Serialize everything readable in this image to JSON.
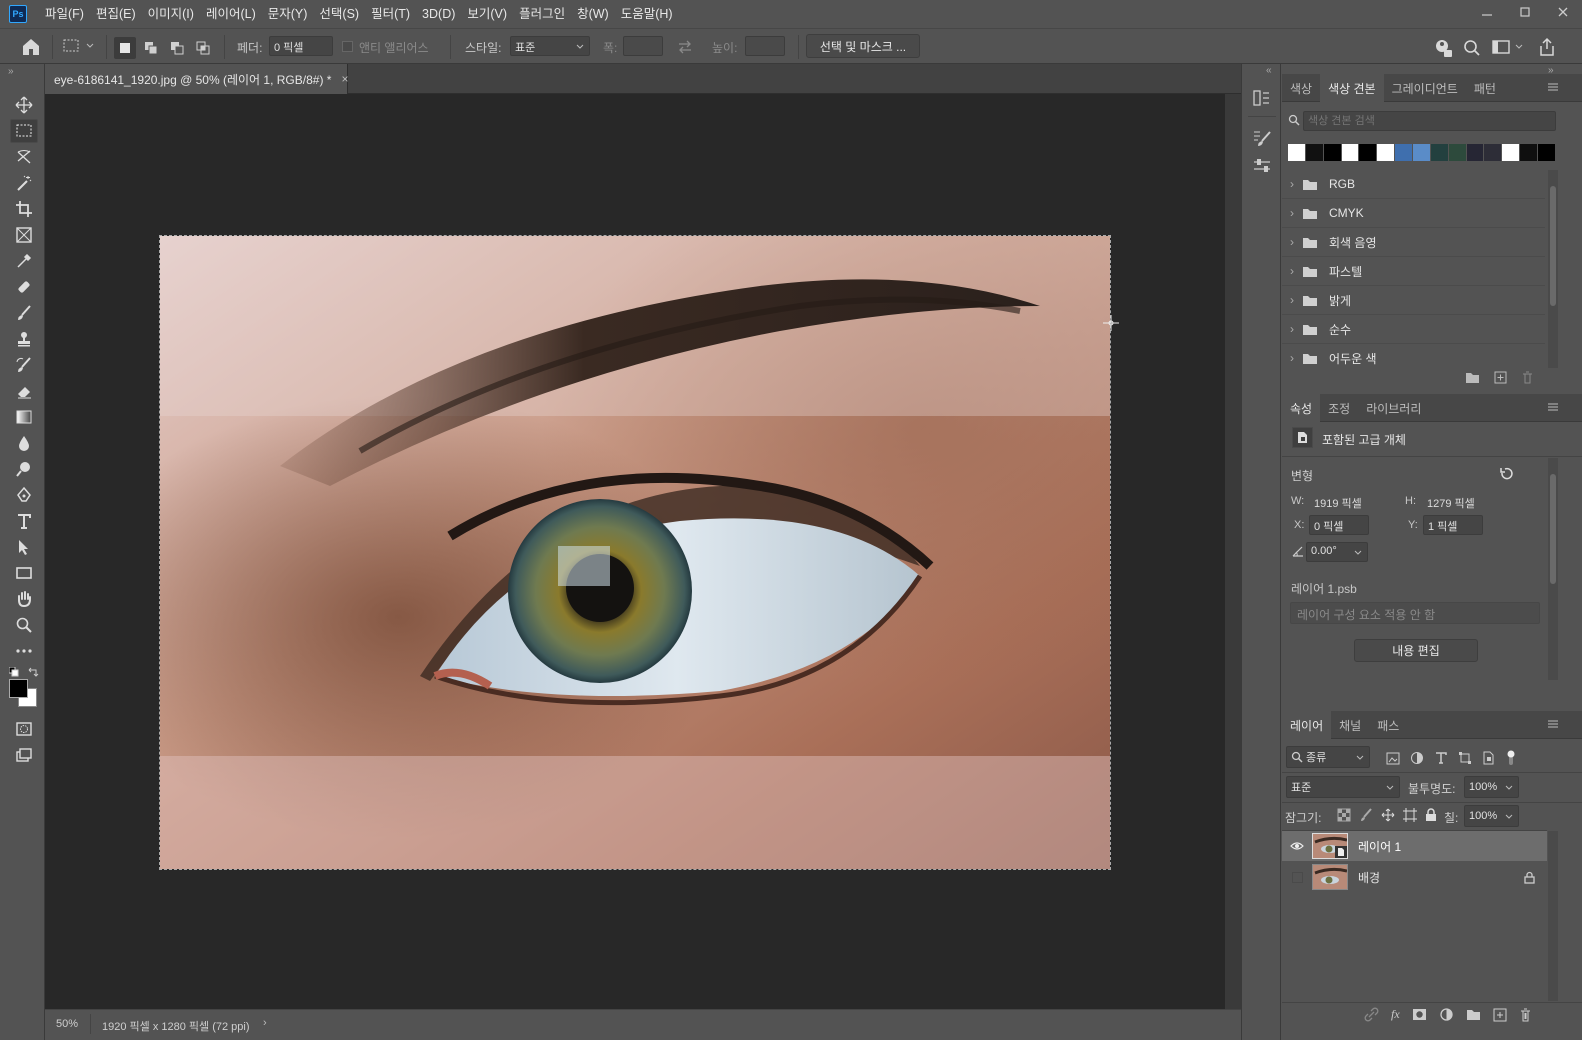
{
  "app": {
    "logo_text": "Ps"
  },
  "menu": [
    "파일(F)",
    "편집(E)",
    "이미지(I)",
    "레이어(L)",
    "문자(Y)",
    "선택(S)",
    "필터(T)",
    "3D(D)",
    "보기(V)",
    "플러그인",
    "창(W)",
    "도움말(H)"
  ],
  "options": {
    "feather_label": "페더:",
    "feather_value": "0 픽셀",
    "antialias_label": "앤티 앨리어스",
    "style_label": "스타일:",
    "style_value": "표준",
    "width_label": "폭:",
    "height_label": "높이:",
    "select_mask_button": "선택 및 마스크 ..."
  },
  "document": {
    "tab_title": "eye-6186141_1920.jpg @ 50% (레이어 1, RGB/8#) *",
    "zoom": "50%",
    "info": "1920 픽셀 x 1280 픽셀 (72 ppi)"
  },
  "swatches_panel": {
    "tabs": [
      "색상",
      "색상 견본",
      "그레이디언트",
      "패턴"
    ],
    "active_tab": "색상 견본",
    "search_placeholder": "색상 견본 검색",
    "swatch_colors": [
      "#ffffff",
      "#111111",
      "#000000",
      "#ffffff",
      "#000000",
      "#ffffff",
      "#3f6fae",
      "#5a8cc8",
      "#23403f",
      "#2d4a3c",
      "#262634",
      "#2d2d37",
      "#ffffff",
      "#0f0f0f",
      "#000000"
    ],
    "groups": [
      "RGB",
      "CMYK",
      "회색 음영",
      "파스텔",
      "밝게",
      "순수",
      "어두운 색"
    ]
  },
  "properties_panel": {
    "tabs": [
      "속성",
      "조정",
      "라이브러리"
    ],
    "active_tab": "속성",
    "object_type": "포함된 고급 개체",
    "section_title": "변형",
    "w_label": "W:",
    "w_value": "1919 픽셀",
    "h_label": "H:",
    "h_value": "1279 픽셀",
    "x_label": "X:",
    "x_value": "0 픽셀",
    "y_label": "Y:",
    "y_value": "1 픽셀",
    "angle_value": "0.00°",
    "linked_file": "레이어 1.psb",
    "layer_comp_value": "레이어 구성 요소 적용 안 함",
    "edit_contents_button": "내용 편집"
  },
  "layers_panel": {
    "tabs": [
      "레이어",
      "채널",
      "패스"
    ],
    "active_tab": "레이어",
    "filter_kind": "종류",
    "blend_mode": "표준",
    "opacity_label": "불투명도:",
    "opacity_value": "100%",
    "lock_label": "잠그기:",
    "fill_label": "칠:",
    "fill_value": "100%",
    "layers": [
      {
        "name": "레이어 1",
        "visible": true,
        "selected": true,
        "locked": false
      },
      {
        "name": "배경",
        "visible": false,
        "selected": false,
        "locked": true
      }
    ]
  },
  "colors": {
    "accent": "#31a8ff",
    "canvas_bg": "#282828",
    "ui_bg": "#535353",
    "foreground": "#000000",
    "background": "#ffffff"
  }
}
